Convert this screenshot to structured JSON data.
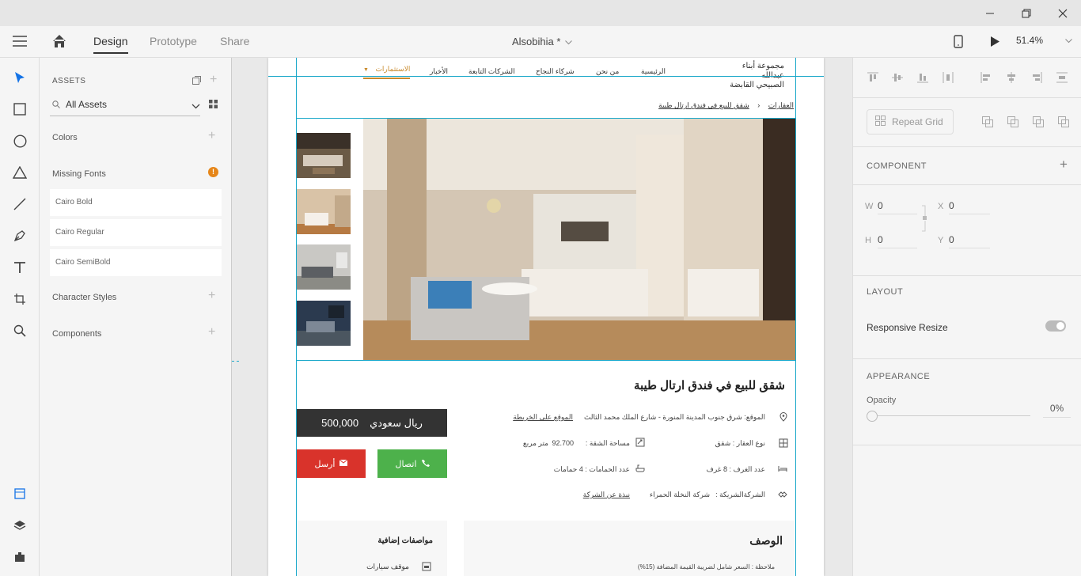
{
  "window": {
    "min_icon": "minimize-icon",
    "restore_icon": "restore-icon",
    "close_icon": "close-icon"
  },
  "appbar": {
    "tabs": [
      "Design",
      "Prototype",
      "Share"
    ],
    "doc_title": "Alsobihia *",
    "zoom": "51.4%"
  },
  "assets": {
    "title": "ASSETS",
    "search_label": "All Assets",
    "colors_label": "Colors",
    "missing_fonts_label": "Missing Fonts",
    "missing_fonts": [
      "Cairo Bold",
      "Cairo Regular",
      "Cairo SemiBold"
    ],
    "char_styles_label": "Character Styles",
    "components_label": "Components"
  },
  "site": {
    "logo_line1": "مجموعة أبناء عبدالله",
    "logo_line2": "الصبيحي القابضة",
    "nav": [
      "الرئيسية",
      "من نحن",
      "شركاء النجاح",
      "الشركات التابعة",
      "الأخبار",
      "الاستثمارات"
    ],
    "breadcrumb_parent": "العقارات",
    "breadcrumb_current": "شقق للبيع في فندق ارتال طيبة",
    "title": "شقق للبيع في فندق ارتال طيبة",
    "location_label": "الموقع: شرق جنوب المدينة المنورة - شارع الملك محمد الثالث",
    "map_link": "الموقع على الخريطة",
    "type_label": "نوع العقار : شقق",
    "area_label": "مساحة الشقة :",
    "area_value": "92.700",
    "area_unit": "متر مربع",
    "rooms_label": "عدد الغرف :  8  غرف",
    "baths_label": "عدد الحمامات :  4  حمامات",
    "company_label": "الشركةالشريكة :",
    "company_name": "شركة النخلة الحمراء",
    "company_link": "نبذة عن الشركة",
    "price": "500,000",
    "currency": "ريال سعودي",
    "call_label": "اتصال",
    "send_label": "أرسل",
    "description_heading": "الوصف",
    "description_note": "ملاحظة : السعر شامل لضريبة القيمة المضافة (15%)",
    "extra_heading": "مواصفات إضافية",
    "extra_item": "موقف سيارات",
    "accent_color": "#c98a2b",
    "call_color": "#4db14b",
    "send_color": "#d9332b",
    "price_bg": "#333333"
  },
  "props": {
    "repeat_grid": "Repeat Grid",
    "component_heading": "COMPONENT",
    "w_label": "W",
    "w_value": "0",
    "x_label": "X",
    "x_value": "0",
    "h_label": "H",
    "h_value": "0",
    "y_label": "Y",
    "y_value": "0",
    "layout_heading": "LAYOUT",
    "responsive_label": "Responsive Resize",
    "appearance_heading": "APPEARANCE",
    "opacity_label": "Opacity",
    "opacity_value": "0%"
  }
}
